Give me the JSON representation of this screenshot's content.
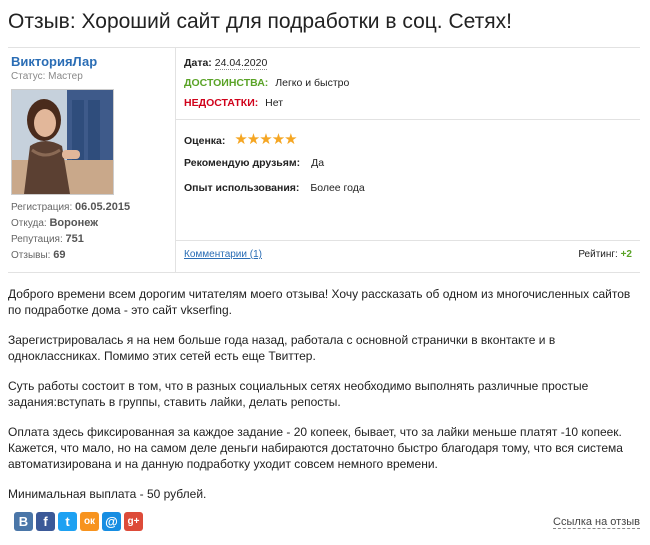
{
  "title": "Отзыв: Хороший сайт для подработки в соц. Сетях!",
  "user": {
    "name": "ВикторияЛар",
    "status_label": "Статус:",
    "status": "Мастер",
    "meta": [
      {
        "label": "Регистрация:",
        "value": "06.05.2015"
      },
      {
        "label": "Откуда:",
        "value": "Воронеж"
      },
      {
        "label": "Репутация:",
        "value": "751"
      },
      {
        "label": "Отзывы:",
        "value": "69"
      }
    ]
  },
  "review": {
    "date_label": "Дата:",
    "date": "24.04.2020",
    "pros_label": "ДОСТОИНСТВА:",
    "pros": "Легко и быстро",
    "cons_label": "НЕДОСТАТКИ:",
    "cons": "Нет",
    "score_label": "Оценка:",
    "score": 5,
    "recommend_label": "Рекомендую друзьям:",
    "recommend": "Да",
    "experience_label": "Опыт использования:",
    "experience": "Более года",
    "comments_link": "Комментарии (1)",
    "rating_label": "Рейтинг:",
    "rating": "+2"
  },
  "body": [
    "Доброго времени всем дорогим читателям моего отзыва! Хочу рассказать об одном из многочисленных сайтов по подработке дома - это сайт vkserfing.",
    "Зарегистрировалась я на нем больше года назад, работала с основной странички в вконтакте и в одноклассниках. Помимо этих сетей есть еще Твиттер.",
    "Суть работы состоит в том, что в разных социальных сетях необходимо выполнять различные простые задания:вступать в группы, ставить лайки, делать репосты.",
    "Оплата здесь фиксированная за каждое задание - 20 копеек, бывает, что за лайки меньше платят -10 копеек. Кажется, что мало, но на самом деле деньги набираются достаточно быстро благодаря тому, что вся система автоматизирована и на данную подработку уходит совсем немного времени.",
    "Минимальная выплата - 50 рублей."
  ],
  "share": [
    {
      "icon": "vk-icon",
      "glyph": "В",
      "color": "#4a76a8"
    },
    {
      "icon": "facebook-icon",
      "glyph": "f",
      "color": "#3b5998"
    },
    {
      "icon": "twitter-icon",
      "glyph": "t",
      "color": "#1da1f2"
    },
    {
      "icon": "odnoklassniki-icon",
      "glyph": "ок",
      "color": "#f7931e"
    },
    {
      "icon": "mailru-icon",
      "glyph": "@",
      "color": "#168de2"
    },
    {
      "icon": "googleplus-icon",
      "glyph": "g+",
      "color": "#dd4b39"
    }
  ],
  "review_link": "Ссылка на отзыв"
}
